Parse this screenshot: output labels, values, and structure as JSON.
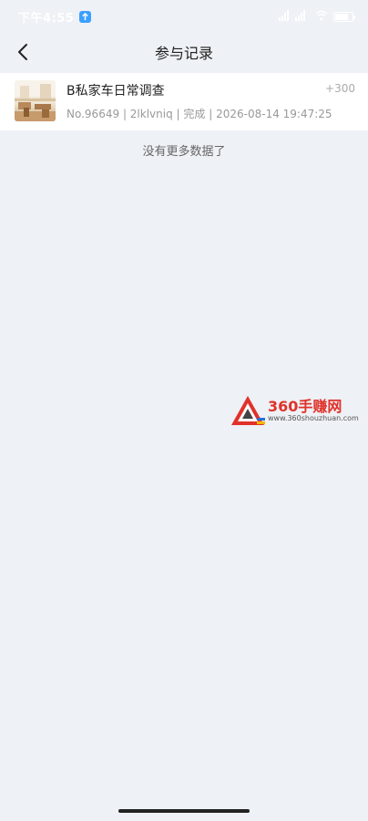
{
  "status_bar": {
    "time": "下午4:55",
    "network": "56 5G",
    "battery_level": 0.8
  },
  "nav": {
    "title": "参与记录"
  },
  "records": [
    {
      "title": "B私家车日常调查",
      "points": "+300",
      "no": "No.96649",
      "user": "2lklvniq",
      "status": "完成",
      "datetime": "2026-08-14 19:47:25"
    }
  ],
  "list_footer": "没有更多数据了",
  "watermark": {
    "name": "360手赚网",
    "url": "www.360shouzhuan.com"
  },
  "colors": {
    "background": "#eef1f5",
    "card": "#ffffff",
    "watermark_red": "#e0322a"
  }
}
